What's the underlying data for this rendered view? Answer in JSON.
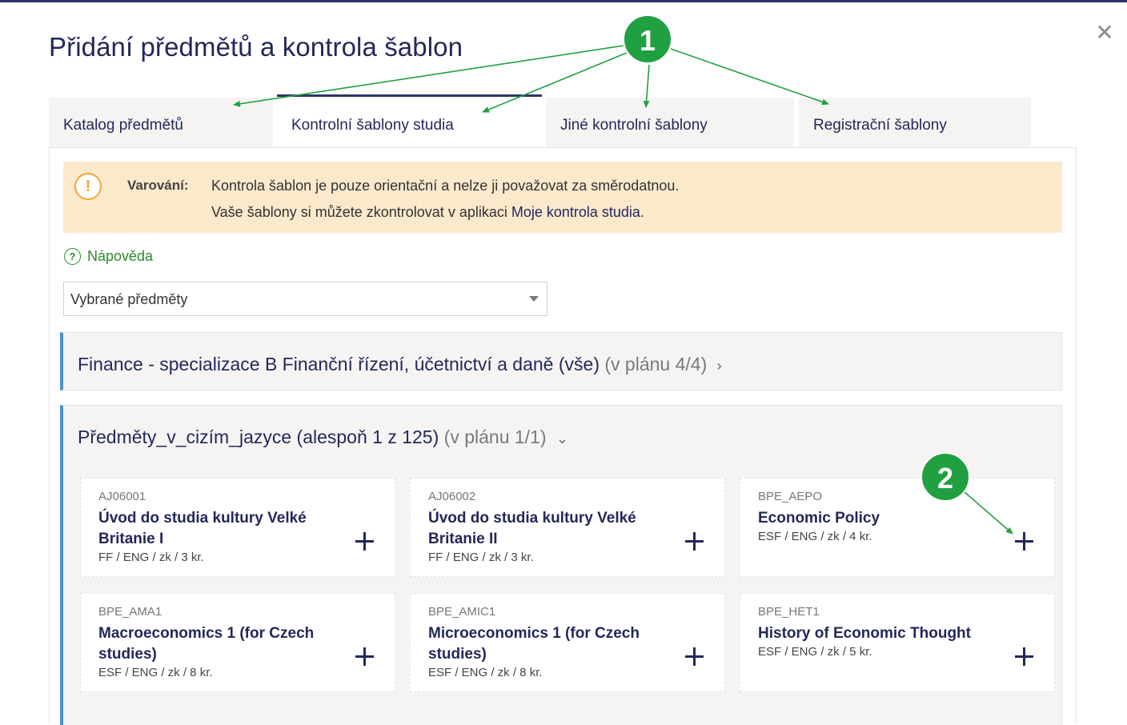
{
  "dialog": {
    "title": "Přidání předmětů a kontrola šablon",
    "close_icon": "close-icon"
  },
  "tabs": [
    {
      "label": "Katalog předmětů",
      "active": false
    },
    {
      "label": "Kontrolní šablony studia",
      "active": true
    },
    {
      "label": "Jiné kontrolní šablony",
      "active": false
    },
    {
      "label": "Registrační šablony",
      "active": false
    }
  ],
  "warning": {
    "icon": "exclamation-icon",
    "label": "Varování:",
    "line1": "Kontrola šablon je pouze orientační a nelze ji považovat za směrodatnou.",
    "line2_prefix": "Vaše šablony si můžete zkontrolovat v aplikaci ",
    "line2_link": "Moje kontrola studia",
    "line2_suffix": "."
  },
  "help": {
    "icon": "question-icon",
    "label": "Nápověda"
  },
  "filter": {
    "selected": "Vybrané předměty"
  },
  "groups": [
    {
      "title": "Finance - specializace B Finanční řízení, účetnictví a daně (vše)",
      "plan": "(v plánu 4/4)",
      "state": "collapsed"
    },
    {
      "title": "Předměty_v_cizím_jazyce (alespoň 1 z 125)",
      "plan": "(v plánu 1/1)",
      "state": "expanded",
      "courses": [
        {
          "code": "AJ06001",
          "name": "Úvod do studia kultury Velké Britanie I",
          "meta": "FF / ENG / zk / 3 kr."
        },
        {
          "code": "AJ06002",
          "name": "Úvod do studia kultury Velké Britanie II",
          "meta": "FF / ENG / zk / 3 kr."
        },
        {
          "code": "BPE_AEPO",
          "name": "Economic Policy",
          "meta": "ESF / ENG / zk / 4 kr."
        },
        {
          "code": "BPE_AMA1",
          "name": "Macroeconomics 1 (for Czech studies)",
          "meta": "ESF / ENG / zk / 8 kr."
        },
        {
          "code": "BPE_AMIC1",
          "name": "Microeconomics 1 (for Czech studies)",
          "meta": "ESF / ENG / zk / 8 kr."
        },
        {
          "code": "BPE_HET1",
          "name": "History of Economic Thought",
          "meta": "ESF / ENG / zk / 5 kr."
        }
      ]
    }
  ],
  "annotations": [
    {
      "label": "1",
      "color": "#21a042"
    },
    {
      "label": "2",
      "color": "#21a042"
    }
  ]
}
